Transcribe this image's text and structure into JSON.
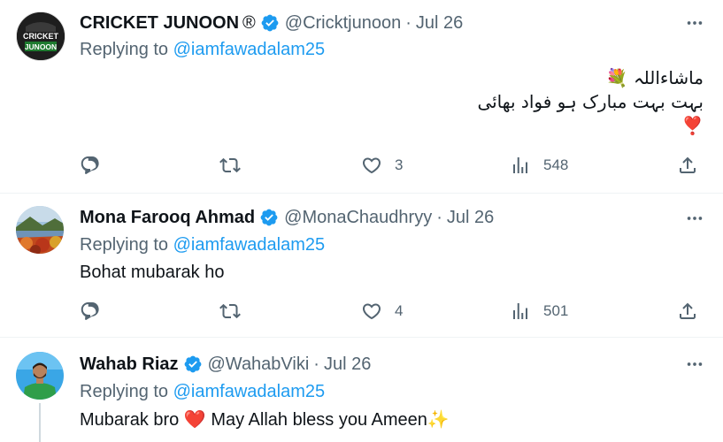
{
  "tweets": [
    {
      "name": "CRICKET JUNOON",
      "registered": "®",
      "handle": "@Cricktjunoon",
      "sep": "·",
      "date": "Jul 26",
      "replying_label": "Replying to",
      "replying_to": "@iamfawadalam25",
      "urdu_line1": "ماشاءاللہ",
      "urdu_line2": "بہت بہت مبارک ہو فواد بھائی",
      "body_emoji_1": "💐",
      "body_emoji_2": "❣️",
      "avatar_text_1": "CRICKET",
      "avatar_text_2": "JUNOON",
      "likes": "3",
      "views": "548"
    },
    {
      "name": "Mona Farooq Ahmad",
      "handle": "@MonaChaudhryy",
      "sep": "·",
      "date": "Jul 26",
      "replying_label": "Replying to",
      "replying_to": "@iamfawadalam25",
      "text": "Bohat mubarak ho",
      "likes": "4",
      "views": "501"
    },
    {
      "name": "Wahab Riaz",
      "handle": "@WahabViki",
      "sep": "·",
      "date": "Jul 26",
      "replying_label": "Replying to",
      "replying_to": "@iamfawadalam25",
      "text_part1": "Mubarak bro",
      "emoji_heart": "❤️",
      "text_part2": "May Allah bless you Ameen",
      "emoji_sparkles": "✨"
    }
  ],
  "colors": {
    "verified": "#1d9bf0",
    "muted": "#536471",
    "mention": "#1d9bf0",
    "divider": "#eff3f4"
  },
  "icons": [
    "verified-badge-icon",
    "more-icon",
    "reply-icon",
    "retweet-icon",
    "like-icon",
    "views-icon",
    "share-icon"
  ]
}
